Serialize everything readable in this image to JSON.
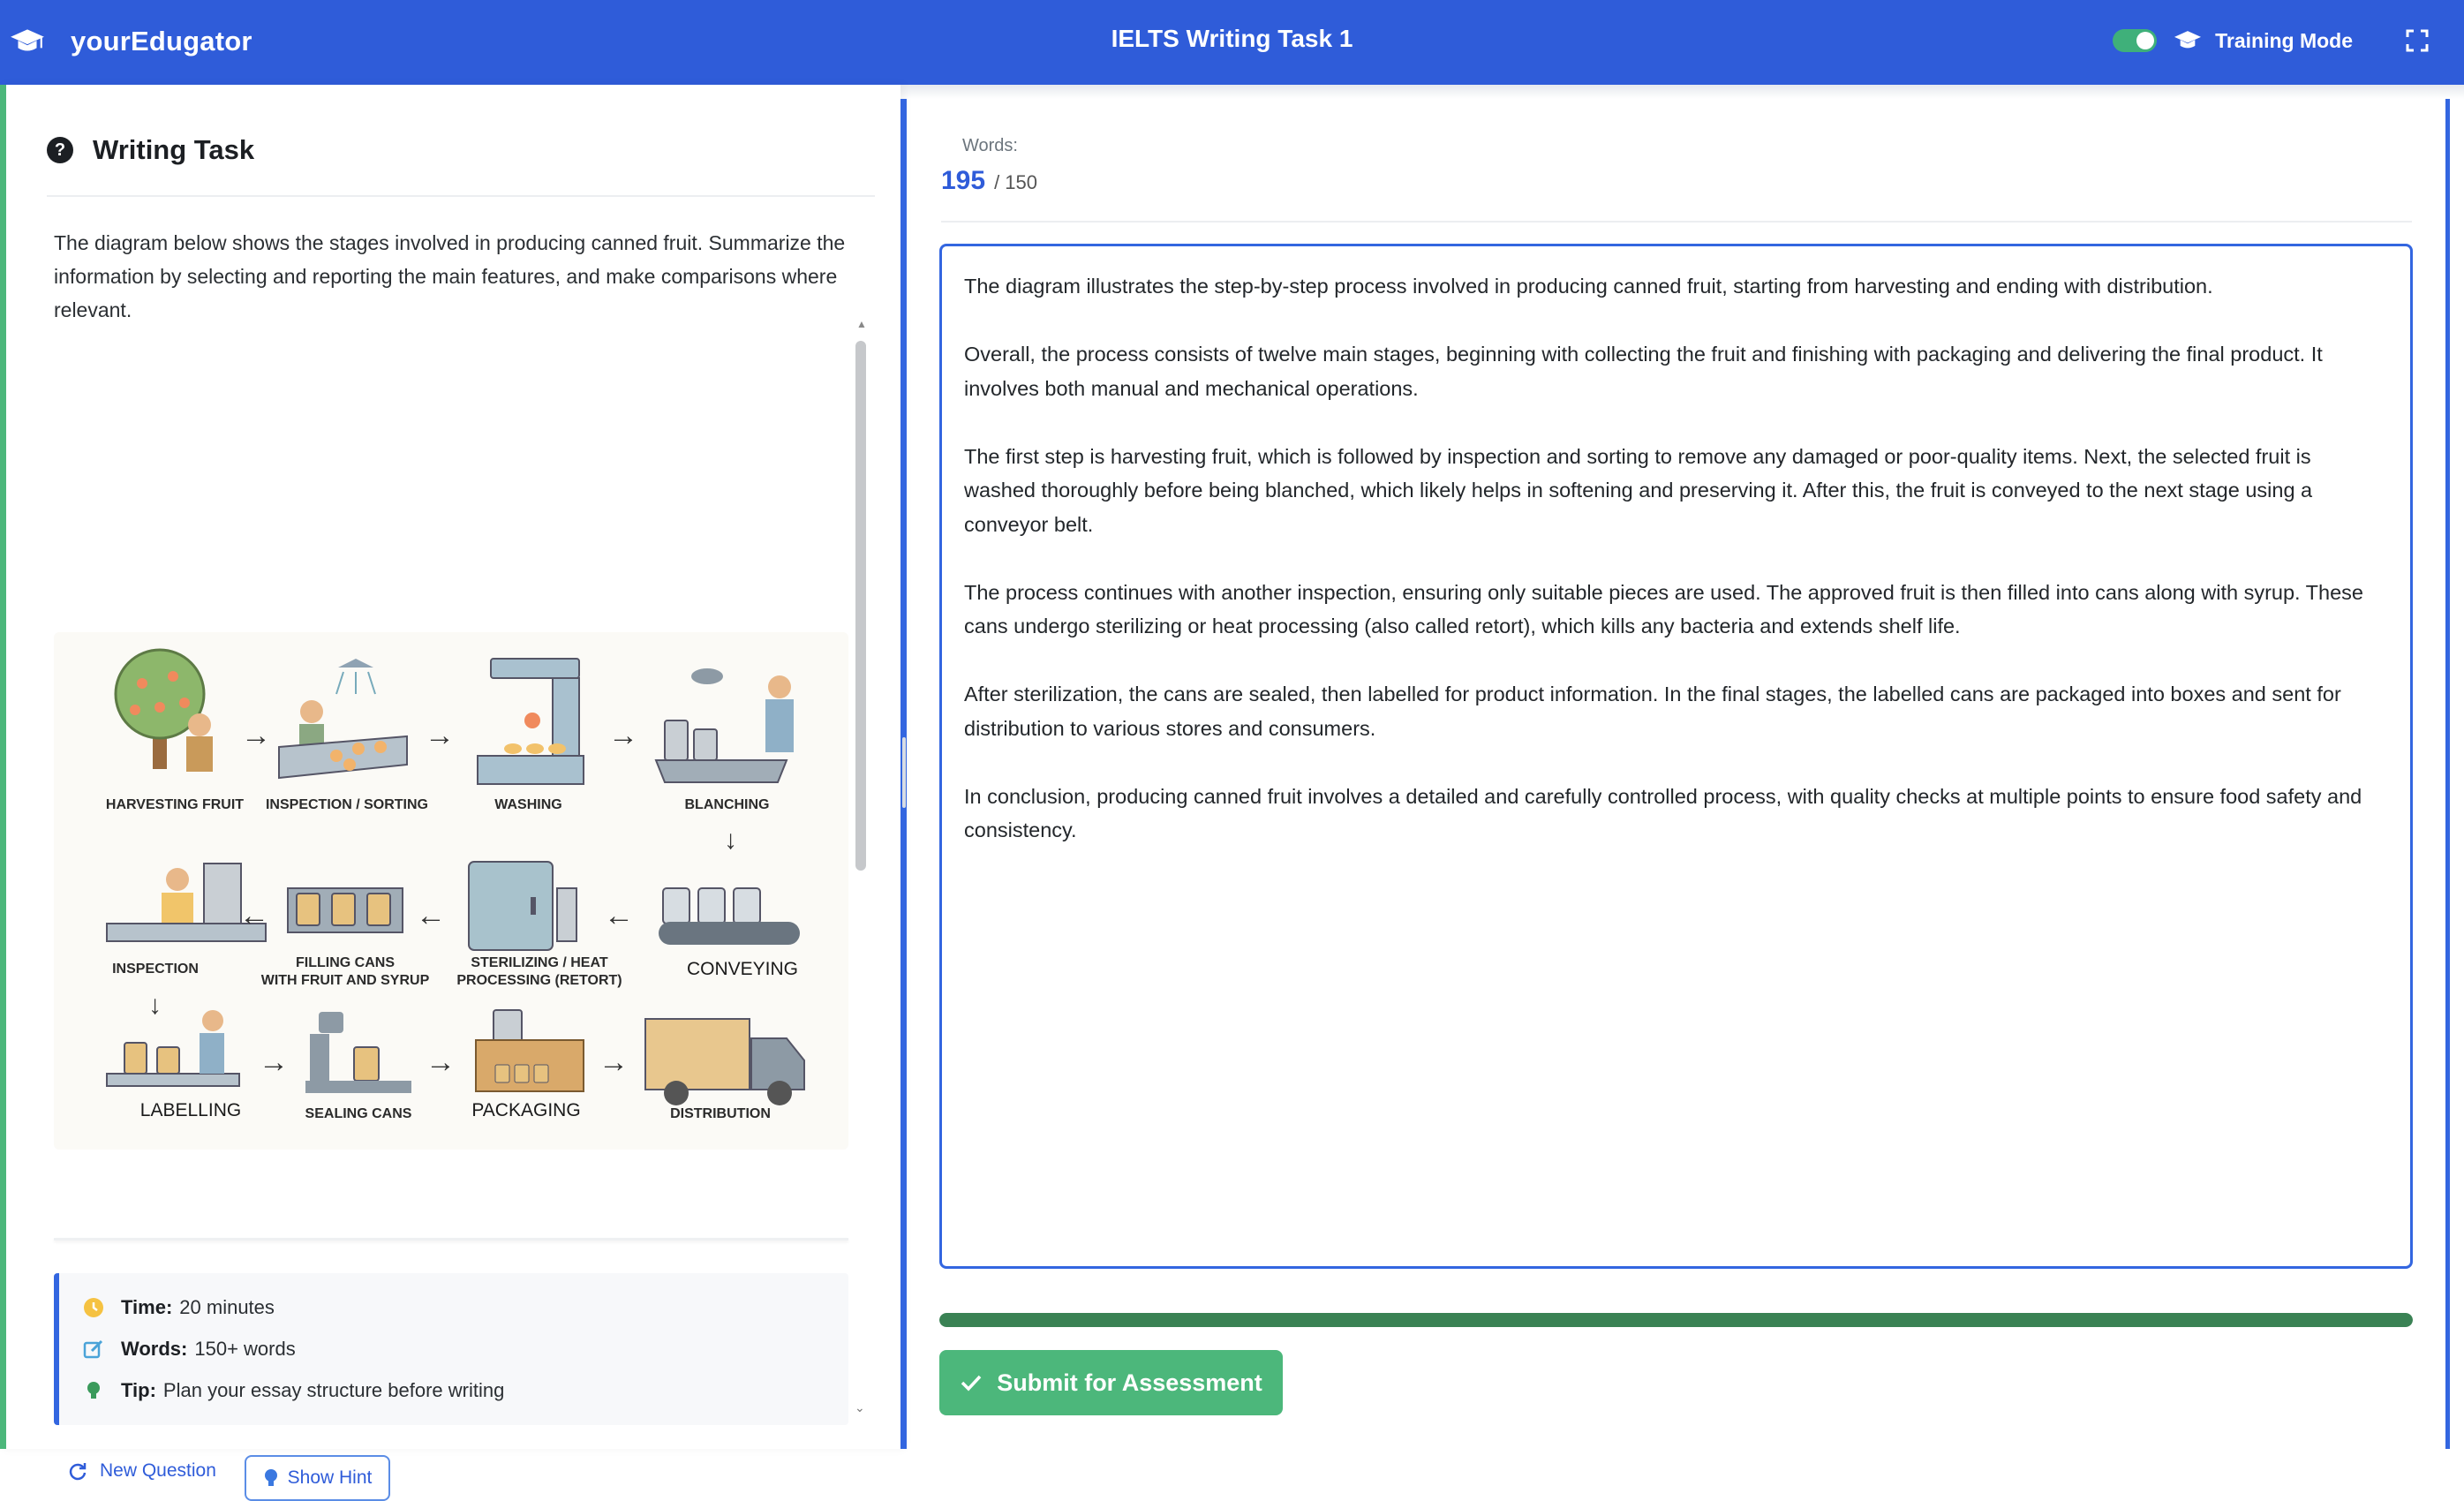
{
  "header": {
    "brand": "yourEdugator",
    "title": "IELTS Writing Task 1",
    "mode_label": "Training Mode",
    "training_mode_on": true
  },
  "task": {
    "heading": "Writing Task",
    "prompt": "The diagram below shows the stages involved in producing canned fruit. Summarize the information by selecting and reporting the main features, and make comparisons where relevant.",
    "stages": {
      "harvesting": "HARVESTING FRUIT",
      "inspection_sorting": "INSPECTION / SORTING",
      "washing": "WASHING",
      "blanching": "BLANCHING",
      "inspection": "INSPECTION",
      "filling_1": "FILLING CANS",
      "filling_2": "WITH FRUIT AND SYRUP",
      "sterilizing_1": "STERILIZING / HEAT",
      "sterilizing_2": "PROCESSING (RETORT)",
      "conveying": "CONVEYING",
      "labelling": "LABELLING",
      "sealing": "SEALING CANS",
      "packaging": "PACKAGING",
      "distribution": "DISTRIBUTION"
    },
    "info": {
      "time_label": "Time:",
      "time_value": "20 minutes",
      "words_label": "Words:",
      "words_value": "150+ words",
      "tip_label": "Tip:",
      "tip_value": "Plan your essay structure before writing"
    }
  },
  "actions": {
    "new_question": "New Question",
    "show_hint": "Show Hint",
    "submit": "Submit for Assessment"
  },
  "editor": {
    "words_label": "Words:",
    "word_count": "195",
    "word_target": "/ 150",
    "progress_fraction": 1.0,
    "paragraphs": [
      "The diagram illustrates the step-by-step process involved in producing canned fruit, starting from harvesting and ending with distribution.",
      "Overall, the process consists of twelve main stages, beginning with collecting the fruit and finishing with packaging and delivering the final product. It involves both manual and mechanical operations.",
      "The first step is harvesting fruit, which is followed by inspection and sorting to remove any damaged or poor-quality items. Next, the selected fruit is washed thoroughly before being blanched, which likely helps in softening and preserving it. After this, the fruit is conveyed to the next stage using a conveyor belt.",
      "The process continues with another inspection, ensuring only suitable pieces are used. The approved fruit is then filled into cans along with syrup. These cans undergo sterilizing or heat processing (also called retort), which kills any bacteria and extends shelf life.",
      "After sterilization, the cans are sealed, then labelled for product information. In the final stages, the labelled cans are packaged into boxes and sent for distribution to various stores and consumers.",
      "In conclusion, producing canned fruit involves a detailed and carefully controlled process, with quality checks at multiple points to ensure food safety and consistency."
    ]
  },
  "icons": {
    "brand": "graduation-cap-icon",
    "mode": "graduation-cap-icon",
    "fullscreen": "expand-icon",
    "question": "question-circle-icon",
    "time": "clock-icon",
    "words": "pencil-square-icon",
    "tip": "lightbulb-icon",
    "new_question": "refresh-icon",
    "hint": "lightbulb-icon",
    "submit": "check-icon"
  },
  "colors": {
    "header_bg": "#2f5cd9",
    "accent_blue": "#3366e0",
    "accent_green": "#4cb77b",
    "progress": "#3a8254"
  }
}
